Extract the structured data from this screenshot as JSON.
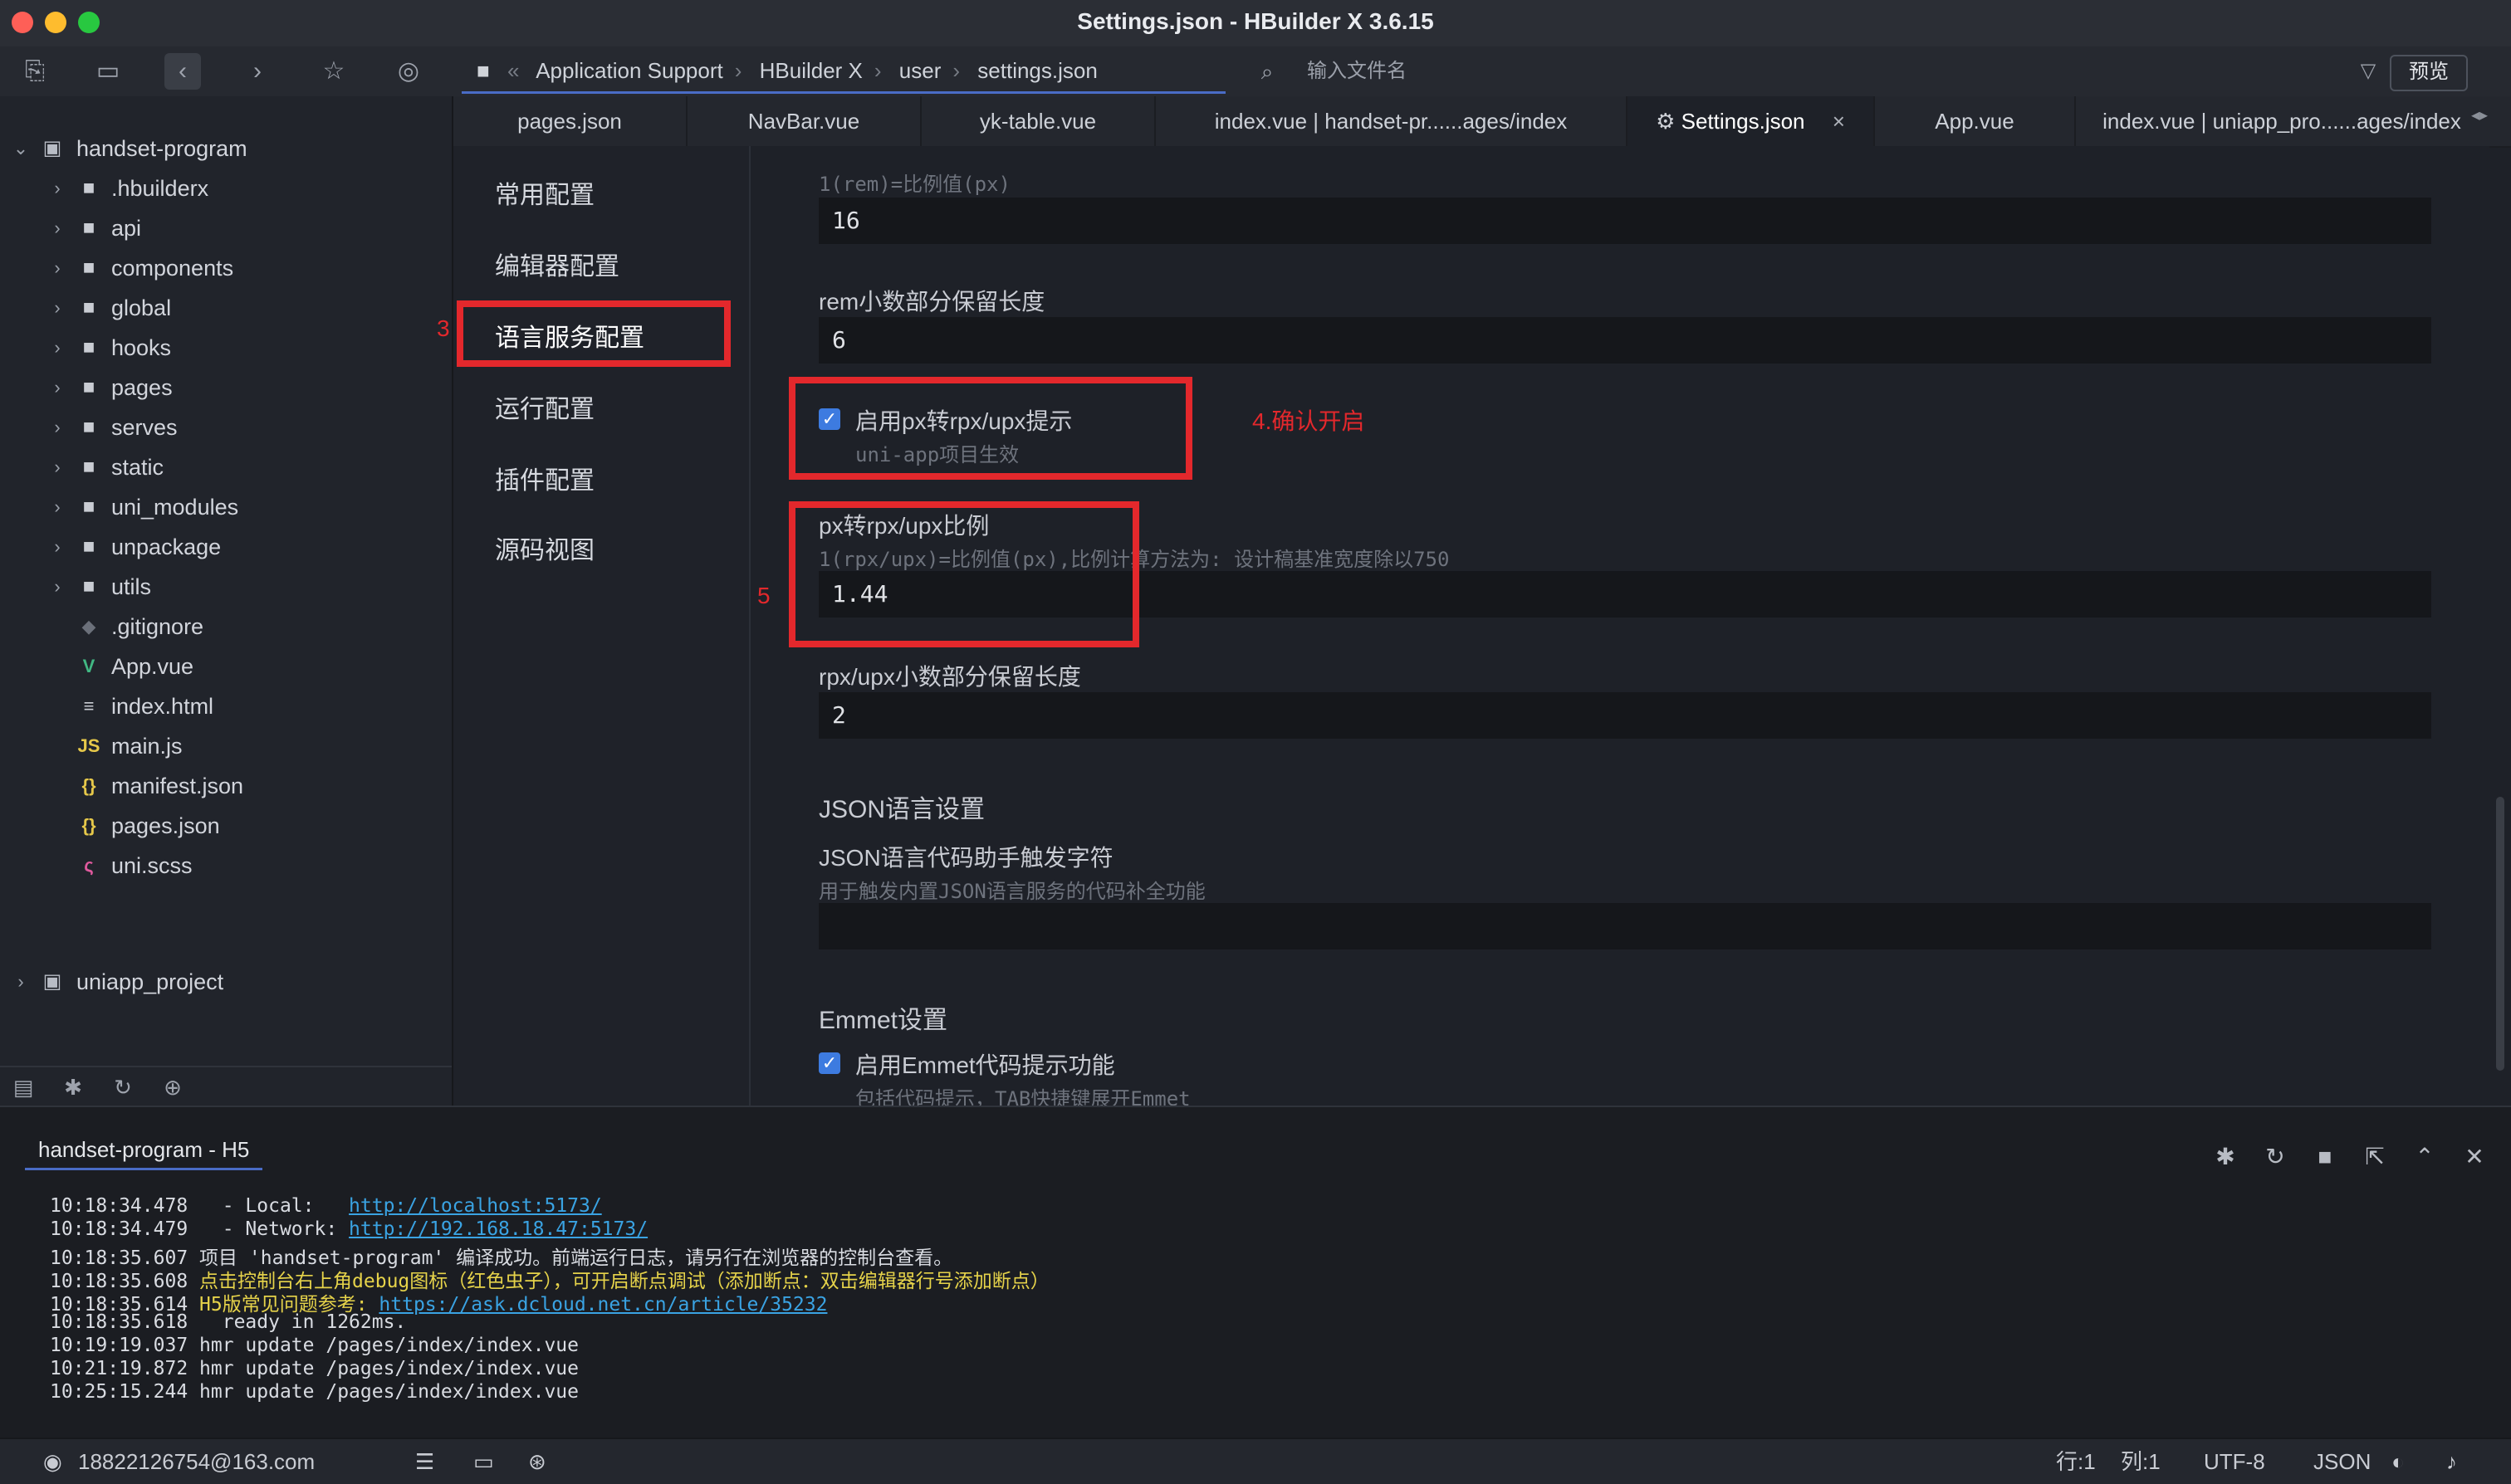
{
  "window": {
    "title": "Settings.json - HBuilder X 3.6.15"
  },
  "toolbar": {
    "breadcrumb": [
      "Application Support",
      "HBuilder X",
      "user",
      "settings.json"
    ],
    "file_search_placeholder": "输入文件名",
    "preview_label": "预览"
  },
  "sidebar": {
    "project": "handset-program",
    "folders": [
      ".hbuilderx",
      "api",
      "components",
      "global",
      "hooks",
      "pages",
      "serves",
      "static",
      "uni_modules",
      "unpackage",
      "utils"
    ],
    "files": [
      {
        "name": ".gitignore",
        "icon": "git-icon"
      },
      {
        "name": "App.vue",
        "icon": "vue-icon"
      },
      {
        "name": "index.html",
        "icon": "html-icon"
      },
      {
        "name": "main.js",
        "icon": "js-icon"
      },
      {
        "name": "manifest.json",
        "icon": "json-icon"
      },
      {
        "name": "pages.json",
        "icon": "json-icon"
      },
      {
        "name": "uni.scss",
        "icon": "scss-icon"
      }
    ],
    "project2": "uniapp_project"
  },
  "tabs": [
    "pages.json",
    "NavBar.vue",
    "yk-table.vue",
    "index.vue | handset-pr......ages/index",
    "Settings.json",
    "App.vue",
    "index.vue | uniapp_pro......ages/index"
  ],
  "settings_nav": [
    "常用配置",
    "编辑器配置",
    "语言服务配置",
    "运行配置",
    "插件配置",
    "源码视图"
  ],
  "settings": {
    "rem_hint": "1(rem)=比例值(px)",
    "rem_value": "16",
    "rem_decimal_label": "rem小数部分保留长度",
    "rem_decimal_value": "6",
    "px_rpx_label": "启用px转rpx/upx提示",
    "px_rpx_hint": "uni-app项目生效",
    "ratio_label": "px转rpx/upx比例",
    "ratio_hint": "1(rpx/upx)=比例值(px),比例计算方法为: 设计稿基准宽度除以750",
    "ratio_value": "1.44",
    "rpx_decimal_label": "rpx/upx小数部分保留长度",
    "rpx_decimal_value": "2",
    "json_section": "JSON语言设置",
    "json_trigger_label": "JSON语言代码助手触发字符",
    "json_trigger_hint": "用于触发内置JSON语言服务的代码补全功能",
    "emmet_section": "Emmet设置",
    "emmet_label": "启用Emmet代码提示功能",
    "emmet_hint": "包括代码提示，TAB快捷键展开Emmet"
  },
  "annotations": {
    "n3": "3",
    "n4": "4.确认开启",
    "n5": "5"
  },
  "console": {
    "tab": "handset-program - H5",
    "lines": [
      {
        "t": "10:18:34.478",
        "pre": "  - Local:   ",
        "link": "http://localhost:5173/",
        "text": ""
      },
      {
        "t": "10:18:34.479",
        "pre": "  - Network: ",
        "link": "http://192.168.18.47:5173/",
        "text": ""
      },
      {
        "t": "10:18:35.607",
        "pre": "",
        "link": "",
        "text": "项目 'handset-program' 编译成功。前端运行日志，请另行在浏览器的控制台查看。"
      },
      {
        "t": "10:18:35.608",
        "pre": "",
        "link": "",
        "text": "点击控制台右上角debug图标（红色虫子），可开启断点调试（添加断点：双击编辑器行号添加断点）"
      },
      {
        "t": "10:18:35.614",
        "pre": "H5版常见问题参考: ",
        "link": "https://ask.dcloud.net.cn/article/35232",
        "text": ""
      },
      {
        "t": "10:18:35.618",
        "pre": "",
        "link": "",
        "text": "  ready in 1262ms."
      },
      {
        "t": "10:19:19.037",
        "pre": "",
        "link": "",
        "text": "hmr update /pages/index/index.vue"
      },
      {
        "t": "10:21:19.872",
        "pre": "",
        "link": "",
        "text": "hmr update /pages/index/index.vue"
      },
      {
        "t": "10:25:15.244",
        "pre": "",
        "link": "",
        "text": "hmr update /pages/index/index.vue"
      }
    ]
  },
  "status": {
    "user": "18822126754@163.com",
    "line": "行:1",
    "col": "列:1",
    "encoding": "UTF-8",
    "lang": "JSON"
  },
  "colors": {
    "accent": "#3d7be0",
    "annotation_red": "#e3282c",
    "link": "#3aa3e3",
    "warn_yellow": "#e6d34a"
  }
}
